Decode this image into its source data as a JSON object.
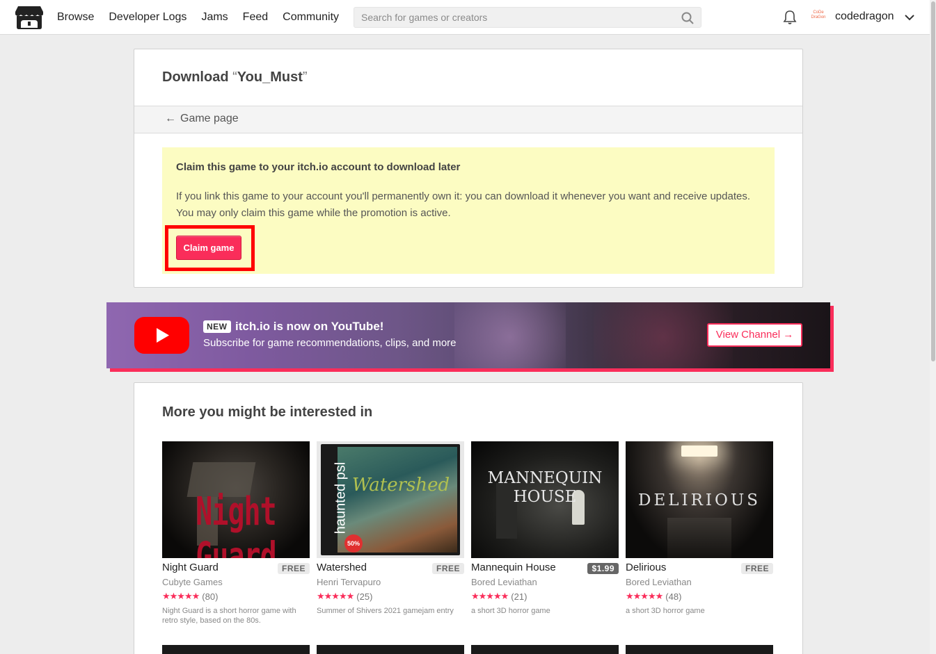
{
  "header": {
    "nav": [
      "Browse",
      "Developer Logs",
      "Jams",
      "Feed",
      "Community"
    ],
    "search_placeholder": "Search for games or creators",
    "username": "codedragon",
    "avatar_text": "CoDe DraGon",
    "icons": [
      "itchio-logo-icon",
      "search-icon",
      "bell-icon",
      "chevron-down-icon"
    ]
  },
  "download": {
    "title_prefix": "Download",
    "open_quote": "“",
    "game_name": "You_Must",
    "close_quote": "”",
    "back_link": "Game page",
    "claim_heading": "Claim this game to your itch.io account to download later",
    "claim_body": "If you link this game to your account you'll permanently own it: you can download it whenever you want and receive updates. You may only claim this game while the promotion is active.",
    "claim_button": "Claim game"
  },
  "youtube": {
    "badge": "NEW",
    "title": "itch.io is now on YouTube!",
    "subtitle": "Subscribe for game recommendations, clips, and more",
    "button": "View Channel →"
  },
  "recommendations": {
    "heading": "More you might be interested in",
    "games": [
      {
        "title": "Night Guard",
        "price": "FREE",
        "author": "Cubyte Games",
        "rating_count": "(80)",
        "desc": "Night Guard is a short horror game with retro style, based on the 80s.",
        "cover_text": "Night Guard"
      },
      {
        "title": "Watershed",
        "price": "FREE",
        "author": "Henri Tervapuro",
        "rating_count": "(25)",
        "desc": "Summer of Shivers 2021 gamejam entry",
        "cover_text": "Watershed",
        "cover_side": "haunted psl",
        "cover_badge": "50%"
      },
      {
        "title": "Mannequin House",
        "price": "$1.99",
        "author": "Bored Leviathan",
        "rating_count": "(21)",
        "desc": "a short 3D horror game",
        "cover_text": "MANNEQUIN HOUSE"
      },
      {
        "title": "Delirious",
        "price": "FREE",
        "author": "Bored Leviathan",
        "rating_count": "(48)",
        "desc": "a short 3D horror game",
        "cover_text": "DELIRIOUS"
      }
    ],
    "stars": "★★★★★"
  },
  "colors": {
    "accent": "#fa2d5a",
    "claim_bg": "#fcfcc2",
    "highlight": "#ff0000"
  }
}
